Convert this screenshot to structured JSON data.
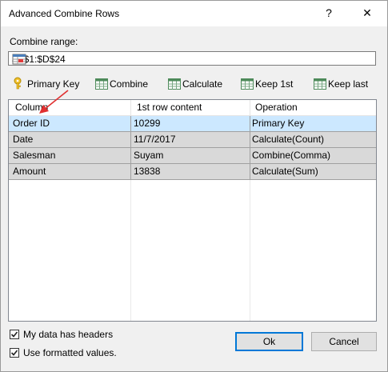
{
  "window": {
    "title": "Advanced Combine Rows",
    "help_label": "?",
    "close_label": "✕"
  },
  "range": {
    "label": "Combine range:",
    "value": "$A$1:$D$24",
    "picker_icon": "range-select-icon"
  },
  "toolbar": [
    {
      "label": "Primary Key",
      "icon": "key-icon"
    },
    {
      "label": "Combine",
      "icon": "table-icon"
    },
    {
      "label": "Calculate",
      "icon": "table-icon"
    },
    {
      "label": "Keep 1st",
      "icon": "table-icon"
    },
    {
      "label": "Keep last",
      "icon": "table-icon"
    }
  ],
  "grid": {
    "columns": [
      "Column",
      "1st row content",
      "Operation"
    ],
    "rows": [
      {
        "column": "Order ID",
        "content": "10299",
        "operation": "Primary Key",
        "selected": true
      },
      {
        "column": "Date",
        "content": "11/7/2017",
        "operation": "Calculate(Count)",
        "selected": false
      },
      {
        "column": "Salesman",
        "content": "Suyam",
        "operation": "Combine(Comma)",
        "selected": false
      },
      {
        "column": "Amount",
        "content": "13838",
        "operation": "Calculate(Sum)",
        "selected": false
      }
    ]
  },
  "options": {
    "headers_label": "My data has headers",
    "headers_checked": true,
    "formatted_label": "Use formatted values.",
    "formatted_checked": true
  },
  "buttons": {
    "ok": "Ok",
    "cancel": "Cancel"
  },
  "colors": {
    "selection": "#cce8ff",
    "row_fill": "#d9d9d9",
    "arrow": "#e03030",
    "default_button_border": "#0078d7"
  }
}
